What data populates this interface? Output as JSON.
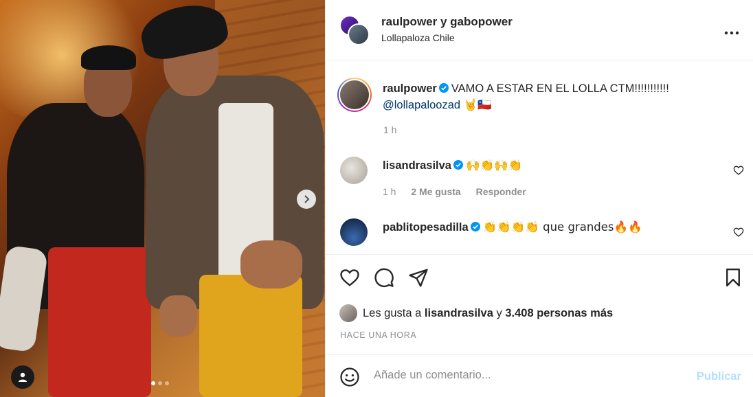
{
  "header": {
    "title": "raulpower y gabopower",
    "location": "Lollapaloza Chile"
  },
  "caption": {
    "username": "raulpower",
    "text": "VAMO A ESTAR EN EL LOLLA CTM!!!!!!!!!!!",
    "mention": "@lollapaloozad",
    "emoji": "🤘🇨🇱",
    "time": "1 h"
  },
  "comments": [
    {
      "username": "lisandrasilva",
      "text": "🙌👏🙌👏",
      "time": "1 h",
      "likes": "2 Me gusta",
      "reply": "Responder"
    },
    {
      "username": "pablitopesadilla",
      "text": "👏👏👏👏 que grandes🔥🔥"
    }
  ],
  "likes": {
    "prefix": "Les gusta a",
    "user": "lisandrasilva",
    "connector": "y",
    "count": "3.408 personas más"
  },
  "posted": "HACE UNA HORA",
  "add_comment": {
    "placeholder": "Añade un comentario...",
    "publish": "Publicar"
  },
  "carousel": {
    "slides": 3,
    "active": 0
  },
  "colors": {
    "verified": "#0095f6",
    "link": "#00376b",
    "publish_disabled": "#b2dffc"
  },
  "icons": [
    "more-icon",
    "verified-icon",
    "heart-icon",
    "comment-icon",
    "share-icon",
    "bookmark-icon",
    "emoji-icon",
    "user-tag-icon",
    "chevron-right-icon"
  ]
}
